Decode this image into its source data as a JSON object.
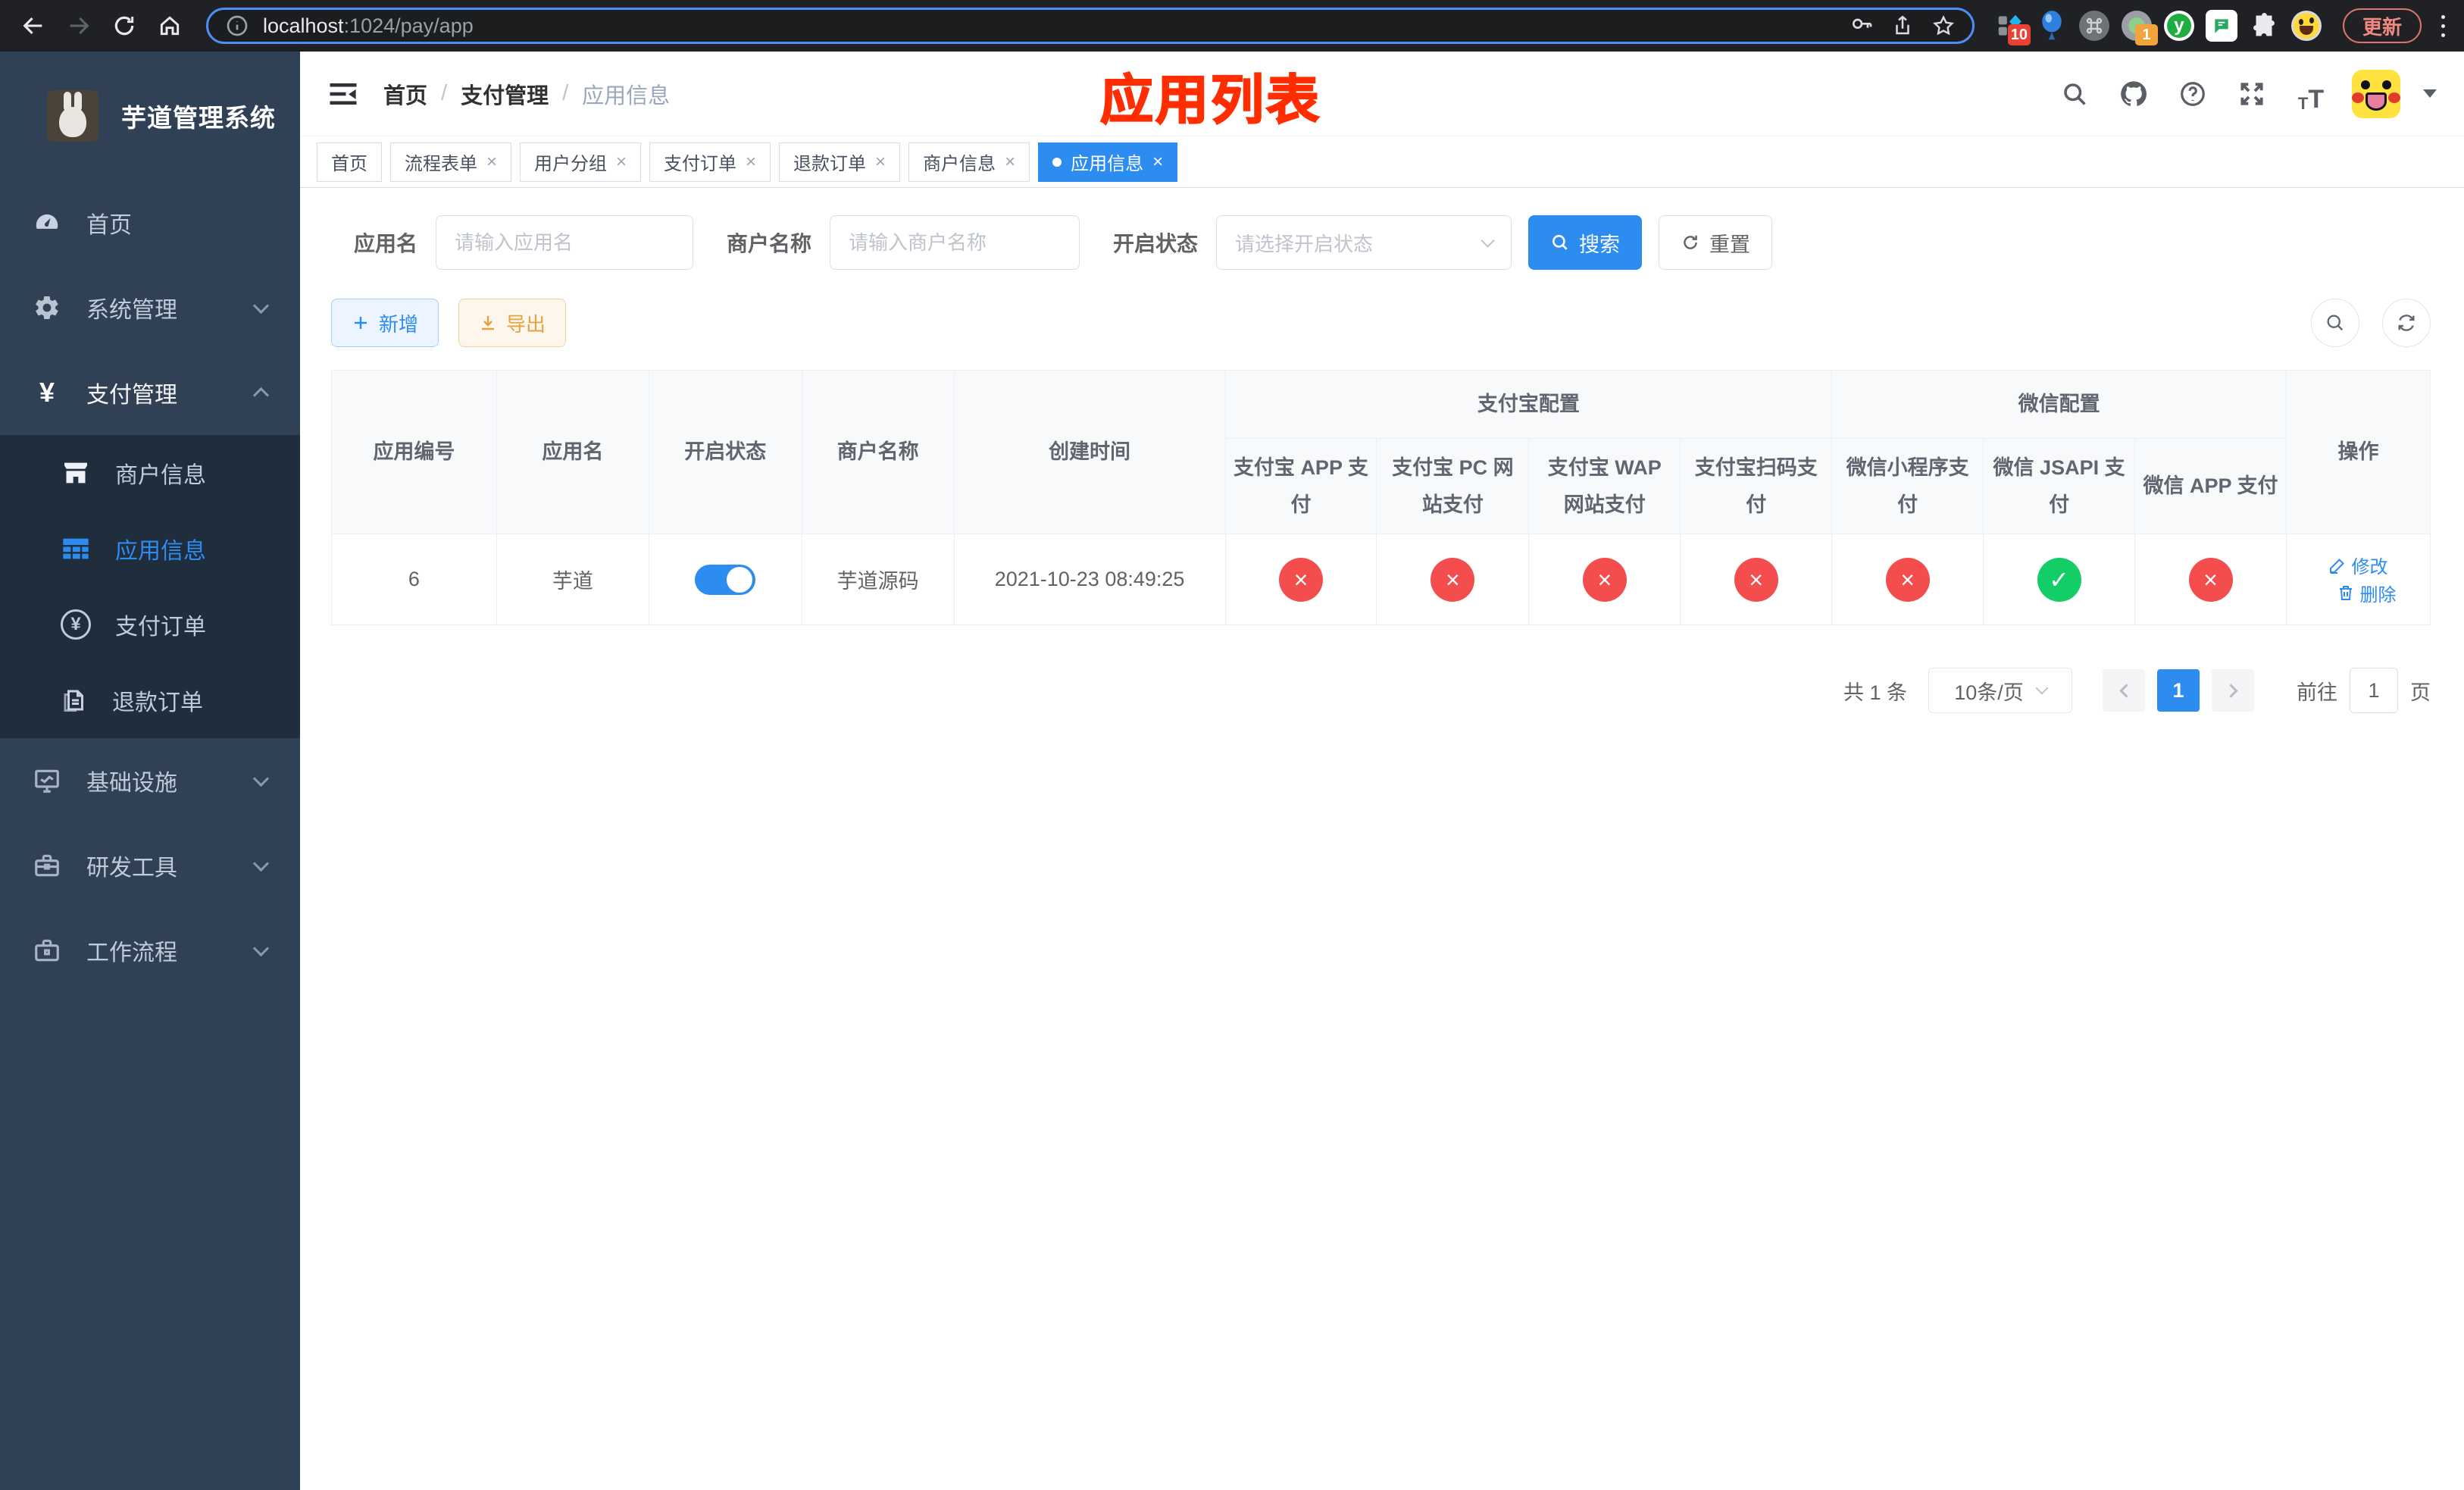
{
  "browser": {
    "url_host": "localhost",
    "url_rest": ":1024/pay/app",
    "update_button": "更新",
    "ext_badge_grid": "10",
    "ext_badge_record": "1"
  },
  "sidebar": {
    "title": "芋道管理系统",
    "items": [
      {
        "label": "首页"
      },
      {
        "label": "系统管理"
      },
      {
        "label": "支付管理"
      },
      {
        "label": "基础设施"
      },
      {
        "label": "研发工具"
      },
      {
        "label": "工作流程"
      }
    ],
    "pay_submenu": [
      {
        "label": "商户信息"
      },
      {
        "label": "应用信息"
      },
      {
        "label": "支付订单"
      },
      {
        "label": "退款订单"
      }
    ]
  },
  "navbar": {
    "breadcrumb": [
      "首页",
      "支付管理",
      "应用信息"
    ],
    "separator": "/",
    "annotation": "应用列表"
  },
  "tags": [
    {
      "label": "首页"
    },
    {
      "label": "流程表单"
    },
    {
      "label": "用户分组"
    },
    {
      "label": "支付订单"
    },
    {
      "label": "退款订单"
    },
    {
      "label": "商户信息"
    },
    {
      "label": "应用信息"
    }
  ],
  "filters": {
    "app_name_label": "应用名",
    "app_name_placeholder": "请输入应用名",
    "merchant_label": "商户名称",
    "merchant_placeholder": "请输入商户名称",
    "status_label": "开启状态",
    "status_placeholder": "请选择开启状态",
    "search_button": "搜索",
    "reset_button": "重置"
  },
  "toolbar": {
    "add_button": "新增",
    "export_button": "导出"
  },
  "table": {
    "headers": {
      "app_id": "应用编号",
      "app_name": "应用名",
      "enabled": "开启状态",
      "merchant": "商户名称",
      "created": "创建时间",
      "alipay_group": "支付宝配置",
      "wechat_group": "微信配置",
      "alipay_app": "支付宝 APP 支付",
      "alipay_pc": "支付宝 PC 网站支付",
      "alipay_wap": "支付宝 WAP 网站支付",
      "alipay_qr": "支付宝扫码支付",
      "wx_mini": "微信小程序支付",
      "wx_jsapi": "微信 JSAPI 支付",
      "wx_app": "微信 APP 支付",
      "actions": "操作"
    },
    "row": {
      "app_id": "6",
      "app_name": "芋道",
      "enabled": true,
      "merchant": "芋道源码",
      "created": "2021-10-23 08:49:25",
      "statuses": [
        false,
        false,
        false,
        false,
        false,
        true,
        false
      ],
      "edit": "修改",
      "delete": "删除"
    }
  },
  "pagination": {
    "total": "共 1 条",
    "per_page": "10条/页",
    "page": "1",
    "goto_prefix": "前往",
    "goto_value": "1",
    "goto_suffix": "页"
  }
}
